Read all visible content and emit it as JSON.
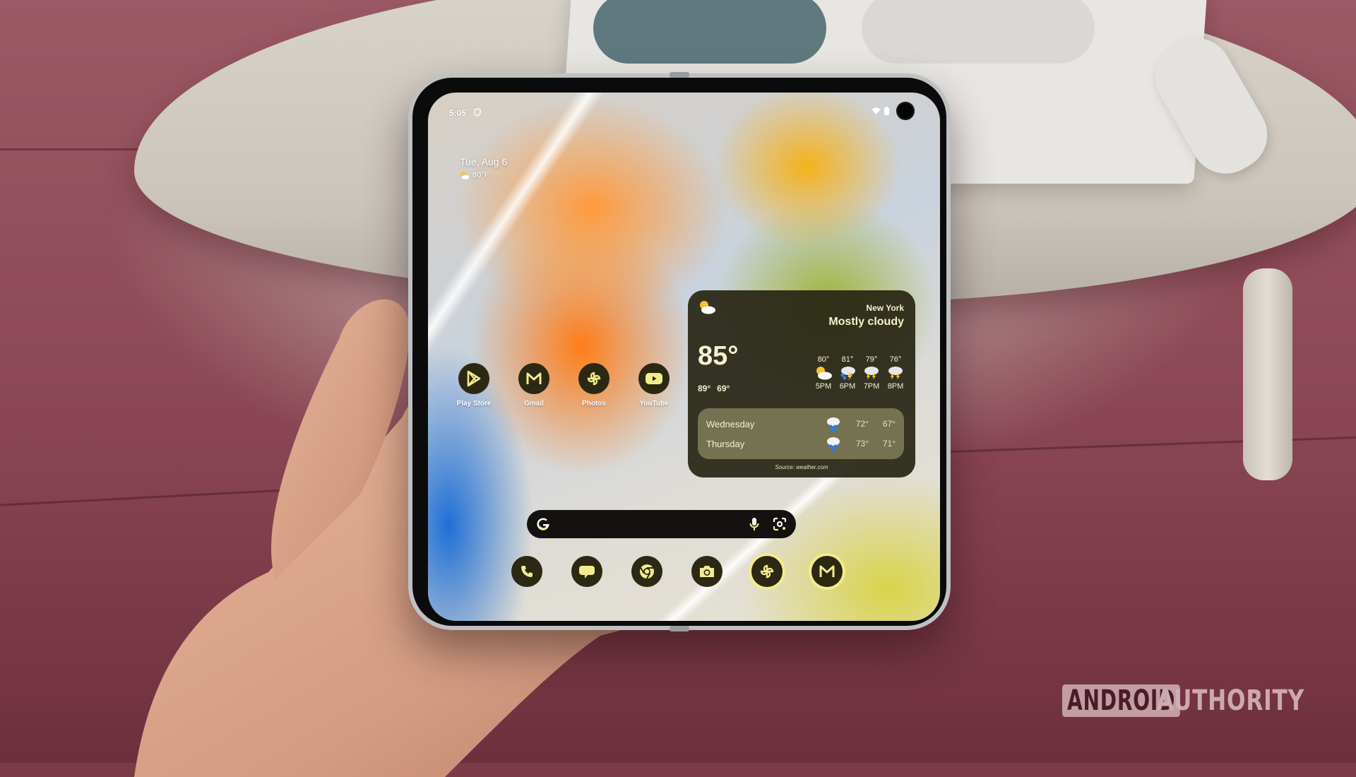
{
  "status_bar": {
    "time": "5:05",
    "left_icons": [
      "shield-icon"
    ],
    "right_icons": [
      "wifi-icon",
      "battery-icon"
    ]
  },
  "at_a_glance": {
    "date": "Tue, Aug 6",
    "weather_icon": "partly-cloudy-icon",
    "temperature": "80°F"
  },
  "weather_widget": {
    "current_icon": "partly-cloudy-icon",
    "city": "New York",
    "condition": "Mostly cloudy",
    "temperature": "85°",
    "high": "89°",
    "low": "69°",
    "hourly": [
      {
        "temp": "80°",
        "icon": "partly-cloudy-icon",
        "time": "5PM"
      },
      {
        "temp": "81°",
        "icon": "thunderstorm-rain-icon",
        "time": "6PM"
      },
      {
        "temp": "79°",
        "icon": "thunderstorm-icon",
        "time": "7PM"
      },
      {
        "temp": "76°",
        "icon": "thunderstorm-icon",
        "time": "8PM"
      }
    ],
    "daily": [
      {
        "day": "Wednesday",
        "icon": "rain-icon",
        "high": "72°",
        "low": "67°"
      },
      {
        "day": "Thursday",
        "icon": "rain-icon",
        "high": "73°",
        "low": "71°"
      }
    ],
    "source": "Source: weather.com"
  },
  "home_apps": [
    {
      "label": "Play Store",
      "icon": "play-store-icon"
    },
    {
      "label": "Gmail",
      "icon": "gmail-icon"
    },
    {
      "label": "Photos",
      "icon": "photos-icon"
    },
    {
      "label": "YouTube",
      "icon": "youtube-icon"
    }
  ],
  "search_bar": {
    "logo": "google-g-icon",
    "actions": [
      "microphone-icon",
      "google-lens-icon"
    ]
  },
  "dock": [
    {
      "icon": "phone-icon",
      "highlighted": false
    },
    {
      "icon": "messages-icon",
      "highlighted": false
    },
    {
      "icon": "chrome-icon",
      "highlighted": false
    },
    {
      "icon": "camera-icon",
      "highlighted": false
    },
    {
      "icon": "photos-icon",
      "highlighted": true
    },
    {
      "icon": "gmail-icon",
      "highlighted": true
    }
  ],
  "colors": {
    "icon_background": "#2b2913",
    "icon_accent": "#f3ec8c",
    "widget_background": "#28261a",
    "widget_text": "#f6f1cf"
  },
  "watermark": {
    "boxed": "ANDROID",
    "plain": "AUTHORITY"
  }
}
